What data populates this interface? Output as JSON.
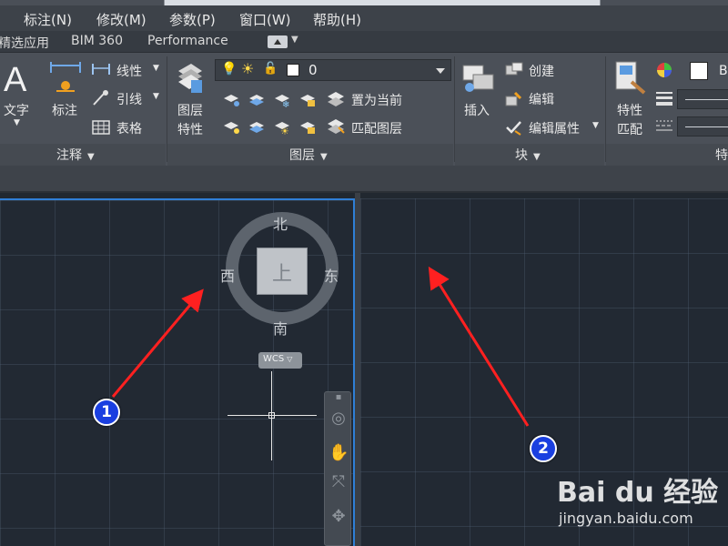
{
  "menubar": {
    "items": [
      "标注(N)",
      "修改(M)",
      "参数(P)",
      "窗口(W)",
      "帮助(H)"
    ]
  },
  "ribbon_tabs": [
    "精选应用",
    "BIM 360",
    "Performance"
  ],
  "ribbon": {
    "annotation_panel": {
      "title": "注释",
      "text_label": "文字",
      "dimension_label": "标注",
      "linear_label": "线性",
      "leader_label": "引线",
      "table_label": "表格"
    },
    "layers_panel": {
      "title": "图层",
      "layer_props_label_1": "图层",
      "layer_props_label_2": "特性",
      "current_layer": "0",
      "set_current_label": "置为当前",
      "match_layer_label": "匹配图层"
    },
    "block_panel": {
      "title": "块",
      "insert_label": "插入",
      "create_label": "创建",
      "edit_label": "编辑",
      "edit_attr_label": "编辑属性"
    },
    "properties_panel": {
      "title": "特",
      "match_label_1": "特性",
      "match_label_2": "匹配",
      "color_value": "By"
    }
  },
  "viewcube": {
    "north": "北",
    "south": "南",
    "west": "西",
    "east": "东",
    "face": "上",
    "wcs": "WCS"
  },
  "annotations": {
    "badge1": "1",
    "badge2": "2"
  },
  "watermark": {
    "logo": "Bai du 经验",
    "url": "jingyan.baidu.com"
  },
  "colors": {
    "accent_blue": "#2f7fd6",
    "arrow_red": "#ff2020",
    "badge_blue": "#1a3fe0"
  }
}
